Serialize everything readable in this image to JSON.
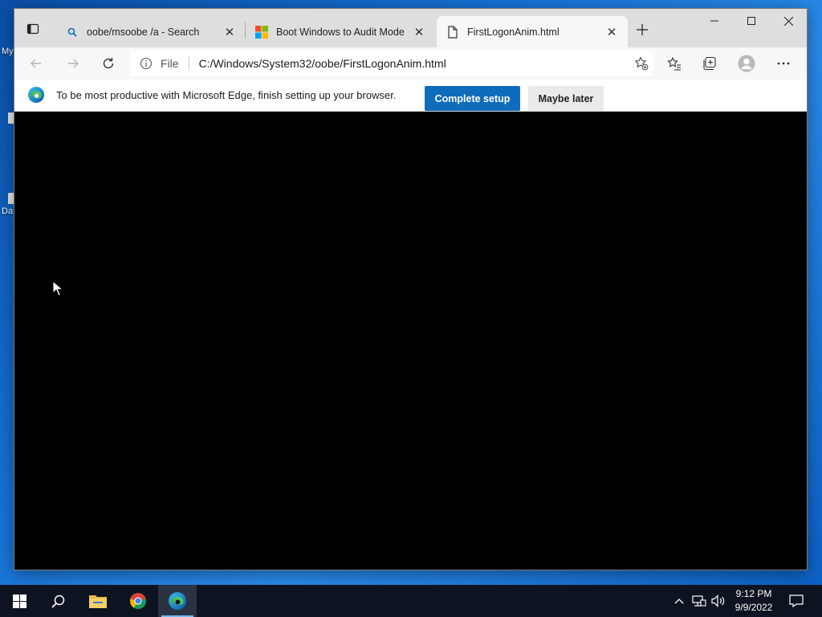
{
  "desktop": {
    "labels": [
      "My",
      "Da"
    ]
  },
  "browser": {
    "tabs": [
      {
        "title": "oobe/msoobe /a - Search",
        "icon": "search-icon",
        "active": false
      },
      {
        "title": "Boot Windows to Audit Mode or",
        "icon": "microsoft-logo-icon",
        "active": false
      },
      {
        "title": "FirstLogonAnim.html",
        "icon": "file-icon",
        "active": true
      }
    ],
    "address": {
      "scheme_label": "File",
      "url": "C:/Windows/System32/oobe/FirstLogonAnim.html"
    },
    "infobar": {
      "message": "To be most productive with Microsoft Edge, finish setting up your browser.",
      "primary_label": "Complete setup",
      "secondary_label": "Maybe later"
    },
    "colors": {
      "accent": "#0f6cbd",
      "content_bg": "#000000",
      "tabstrip_bg": "#dedede"
    }
  },
  "taskbar": {
    "pinned": [
      "windows-start-icon",
      "search-icon",
      "file-explorer-icon",
      "chrome-icon",
      "edge-icon"
    ],
    "clock": {
      "time": "9:12 PM",
      "date": "9/9/2022"
    }
  }
}
